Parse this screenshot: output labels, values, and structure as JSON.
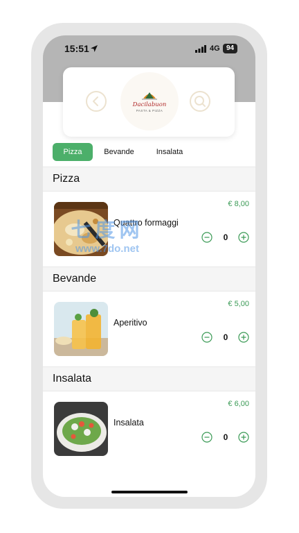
{
  "status_bar": {
    "time": "15:51",
    "network": "4G",
    "battery": "94"
  },
  "header": {
    "logo": {
      "name": "Dacilabuon",
      "subtitle": "PASTA & PIZZA"
    },
    "back_icon": "chevron-left-icon",
    "search_icon": "search-icon"
  },
  "tabs": [
    {
      "label": "Pizza",
      "active": true
    },
    {
      "label": "Bevande",
      "active": false
    },
    {
      "label": "Insalata",
      "active": false
    }
  ],
  "sections": [
    {
      "title": "Pizza",
      "items": [
        {
          "name": "Quattro formaggi",
          "price": "€ 8,00",
          "quantity": "0"
        }
      ]
    },
    {
      "title": "Bevande",
      "items": [
        {
          "name": "Aperitivo",
          "price": "€ 5,00",
          "quantity": "0"
        }
      ]
    },
    {
      "title": "Insalata",
      "items": [
        {
          "name": "Insalata",
          "price": "€ 6,00",
          "quantity": "0"
        }
      ]
    }
  ],
  "watermark": {
    "chinese": "七度网",
    "url": "www.7do.net"
  },
  "colors": {
    "accent": "#4caf6a",
    "price": "#3a9a55",
    "header_bg": "#b5b5b5",
    "section_bg": "#f5f5f5"
  }
}
